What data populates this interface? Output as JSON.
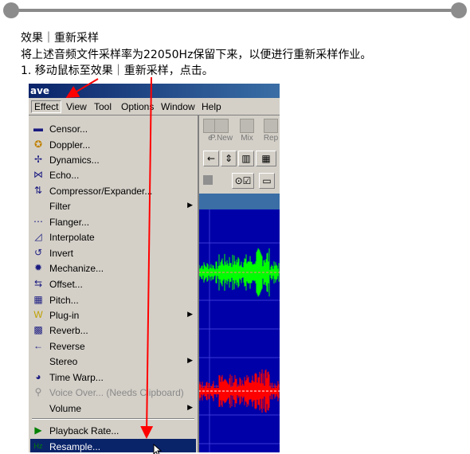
{
  "heading": "效果｜重新采样",
  "description": "将上述音频文件采样率为22050Hz保留下来，以便进行重新采样作业。",
  "step": "1. 移动鼠标至效果｜重新采样，点击。",
  "window": {
    "title_fragment": "ave",
    "menubar": [
      "Effect",
      "View",
      "Tool",
      "Options",
      "Window",
      "Help"
    ],
    "toolbar_buttons": [
      "e",
      "P.New",
      "Mix",
      "Rep"
    ]
  },
  "effect_menu": {
    "items": [
      {
        "label": "Censor...",
        "icon": "censor-icon"
      },
      {
        "label": "Doppler...",
        "icon": "doppler-icon"
      },
      {
        "label": "Dynamics...",
        "icon": "dynamics-icon"
      },
      {
        "label": "Echo...",
        "icon": "echo-icon"
      },
      {
        "label": "Compressor/Expander...",
        "icon": "compressor-icon"
      },
      {
        "label": "Filter",
        "icon": "",
        "submenu": true
      },
      {
        "label": "Flanger...",
        "icon": "flanger-icon"
      },
      {
        "label": "Interpolate",
        "icon": "interpolate-icon"
      },
      {
        "label": "Invert",
        "icon": "invert-icon"
      },
      {
        "label": "Mechanize...",
        "icon": "mechanize-icon"
      },
      {
        "label": "Offset...",
        "icon": "offset-icon"
      },
      {
        "label": "Pitch...",
        "icon": "pitch-icon"
      },
      {
        "label": "Plug-in",
        "icon": "plugin-icon",
        "submenu": true
      },
      {
        "label": "Reverb...",
        "icon": "reverb-icon"
      },
      {
        "label": "Reverse",
        "icon": "reverse-icon"
      },
      {
        "label": "Stereo",
        "icon": "",
        "submenu": true
      },
      {
        "label": "Time Warp...",
        "icon": "time-warp-icon"
      },
      {
        "label": "Voice Over... (Needs Clipboard)",
        "icon": "voice-over-icon",
        "disabled": true
      },
      {
        "label": "Volume",
        "icon": "",
        "submenu": true
      },
      {
        "label": "Playback Rate...",
        "icon": "playback-rate-icon"
      },
      {
        "label": "Resample...",
        "icon": "resample-icon",
        "selected": true
      }
    ]
  },
  "colors": {
    "highlight": "#0a246a",
    "arrow": "#ff0000",
    "wave_bg": "#0000a8",
    "wave_top": "#00ff00",
    "wave_bottom": "#ff0000"
  }
}
